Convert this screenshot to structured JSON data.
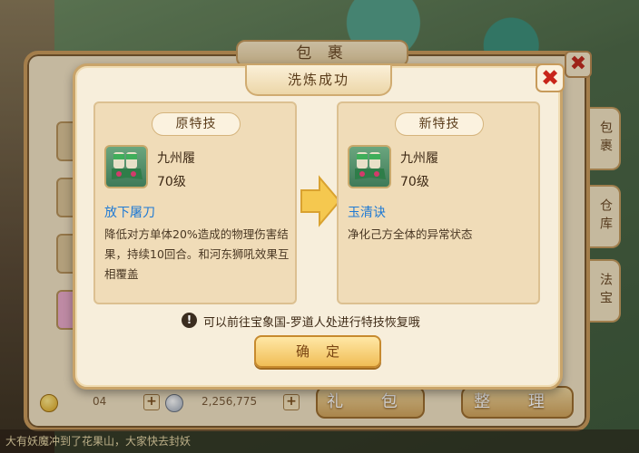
{
  "background": {
    "bag_title": "包 裹",
    "side_tabs": [
      "包裹",
      "仓库",
      "法宝"
    ],
    "gold_count": "04",
    "silver_count": "2,256,775",
    "buttons": [
      "礼 包",
      "整 理"
    ],
    "chat_text": "大有妖魔冲到了花果山，大家快去封妖"
  },
  "modal": {
    "title": "洗炼成功",
    "close_symbol": "✖",
    "original": {
      "header": "原特技",
      "item_name": "九州履",
      "item_level": "70级",
      "skill_name": "放下屠刀",
      "skill_desc": "降低对方单体20%造成的物理伤害结果，持续10回合。和河东狮吼效果互相覆盖"
    },
    "new": {
      "header": "新特技",
      "item_name": "九州履",
      "item_level": "70级",
      "skill_name": "玉清诀",
      "skill_desc": "净化己方全体的异常状态"
    },
    "hint_icon": "!",
    "hint": "可以前往宝象国-罗道人处进行特技恢复哦",
    "confirm_label": "确定"
  },
  "colors": {
    "skill_name": "#1f7ad4",
    "close_x": "#c8251a",
    "confirm_bg": "#f0bd56"
  },
  "icons": {
    "item": "boots-icon",
    "arrow": "arrow-right-icon",
    "hint": "exclamation-circle-icon"
  }
}
